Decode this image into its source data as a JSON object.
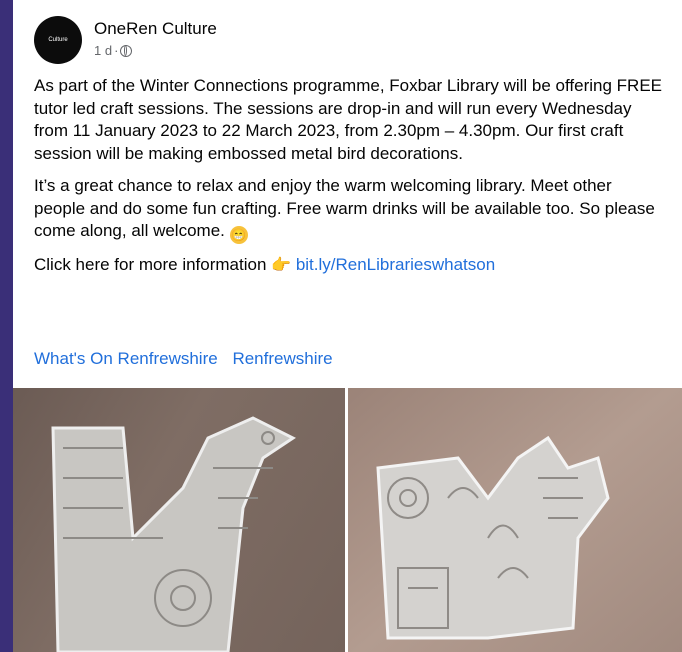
{
  "post": {
    "page_name": "OneRen Culture",
    "avatar_text": "Culture",
    "time": "1 d",
    "separator": "·",
    "paragraphs": [
      "As part of the Winter Connections programme, Foxbar Library will be offering FREE tutor led craft sessions. The sessions are drop-in and will run every Wednesday from 11 January 2023 to 22 March 2023, from 2.30pm – 4.30pm. Our first craft session will be making embossed metal bird decorations.",
      "It’s a great chance to relax and enjoy the warm welcoming library. Meet other people and do some fun crafting. Free warm drinks will be available too. So please come along, all welcome."
    ],
    "emoji": "😁",
    "info_text": "Click here for more information",
    "info_emoji": "👉",
    "link": "bit.ly/RenLibrarieswhatson",
    "hashtags": [
      "What's On Renfrewshire",
      "Renfrewshire"
    ]
  },
  "colors": {
    "background": "#3a2f78",
    "link": "#216fdb",
    "meta": "#65676b"
  },
  "icons": {
    "privacy": "globe-icon",
    "pointing": "pointing-hand-icon"
  }
}
